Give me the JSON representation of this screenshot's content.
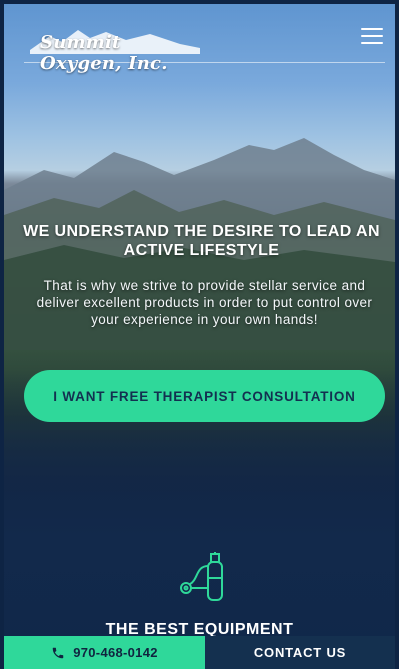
{
  "header": {
    "logo_text": "Summit Oxygen, Inc.",
    "menu_icon": "hamburger-menu-icon"
  },
  "hero": {
    "headline": "WE UNDERSTAND THE DESIRE TO LEAD AN ACTIVE LIFESTYLE",
    "subtext": "That is why we strive to provide stellar service and deliver excellent products in order to put control over your experience in your own hands!",
    "cta_label": "I WANT FREE THERAPIST CONSULTATION"
  },
  "section": {
    "icon": "oxygen-tank-icon",
    "title": "THE BEST EQUIPMENT"
  },
  "footer": {
    "phone_icon": "phone-icon",
    "phone": "970-468-0142",
    "contact_label": "CONTACT US"
  },
  "colors": {
    "accent": "#2fd89a",
    "dark_navy": "#14304f"
  }
}
